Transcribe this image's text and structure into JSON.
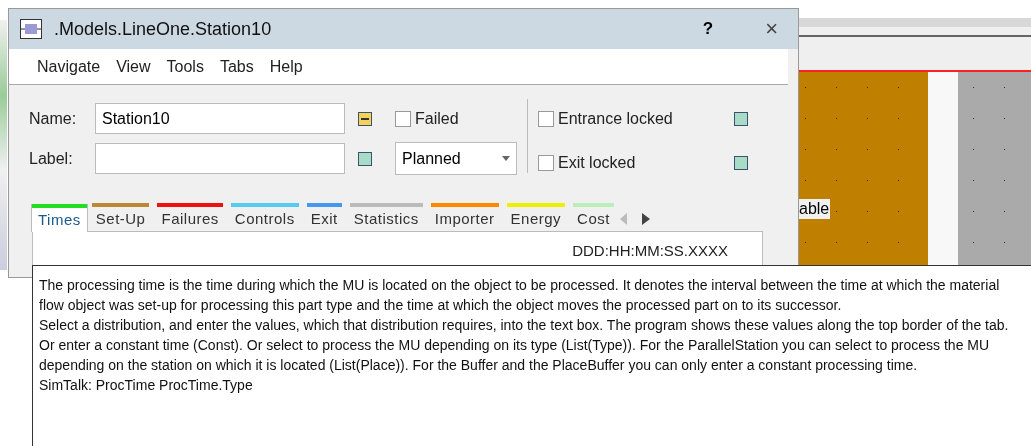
{
  "window": {
    "title": ".Models.LineOne.Station10",
    "help": "?",
    "close": "×"
  },
  "menu": [
    "Navigate",
    "View",
    "Tools",
    "Tabs",
    "Help"
  ],
  "name_field": {
    "label": "Name:",
    "value": "Station10"
  },
  "label_field": {
    "label": "Label:"
  },
  "failed": {
    "label": "Failed",
    "checked": false
  },
  "mode": {
    "value": "Planned"
  },
  "entrance_locked": {
    "label": "Entrance locked",
    "checked": false
  },
  "exit_locked": {
    "label": "Exit locked",
    "checked": false
  },
  "tabs": [
    {
      "label": "Times",
      "color": "#22dd22",
      "selected": true
    },
    {
      "label": "Set-Up",
      "color": "#bb8833",
      "selected": false
    },
    {
      "label": "Failures",
      "color": "#ee1111",
      "selected": false
    },
    {
      "label": "Controls",
      "color": "#55ccee",
      "selected": false
    },
    {
      "label": "Exit",
      "color": "#4499ee",
      "selected": false
    },
    {
      "label": "Statistics",
      "color": "#bbbbbb",
      "selected": false
    },
    {
      "label": "Importer",
      "color": "#ff8800",
      "selected": false
    },
    {
      "label": "Energy",
      "color": "#eeee00",
      "selected": false
    },
    {
      "label": "Cost",
      "color": "#bbeebb",
      "selected": false
    }
  ],
  "time_format": "DDD:HH:MM:SS.XXXX",
  "canvas_label": "able",
  "tooltip": [
    "The processing time is the time during which the MU is located on the object to be processed. It denotes the interval between the time at which the material flow object was set-up for processing this part type and the time at which the object moves the processed part on to its successor.",
    "Select a distribution, and enter the values, which that distribution requires, into the text box. The program shows these values along the top border of the tab. Or enter a constant time (Const). Or select to process the MU depending on its type (List(Type)). For the ParallelStation you can select to process the MU depending on the station on which it is located (List(Place)). For the Buffer and the PlaceBuffer you can only enter a constant processing time.",
    "SimTalk: ProcTime ProcTime.Type"
  ]
}
